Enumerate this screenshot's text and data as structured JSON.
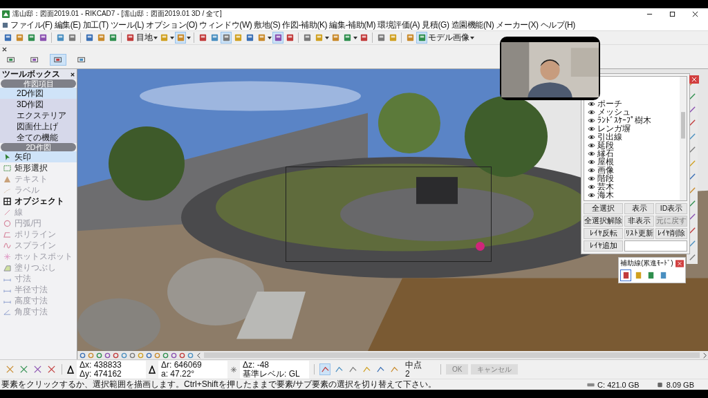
{
  "title_bar": {
    "title": "濡山邸：図面2019.01 - RIKCAD7 - [濡山邸：図面2019.01 3D / 全て]"
  },
  "menu": [
    "ファイル(F)",
    "編集(E)",
    "加工(T)",
    "ツール(L)",
    "オプション(O)",
    "ウィンドウ(W)",
    "敷地(S)",
    "作図-補助(K)",
    "編集-補助(M)",
    "環境評価(A)",
    "見積(G)",
    "造園機能(N)",
    "メーカー(X)",
    "ヘルプ(H)"
  ],
  "toolbar": [
    {
      "kind": "icon",
      "pressed": false
    },
    {
      "kind": "icon",
      "pressed": false
    },
    {
      "kind": "icon",
      "pressed": false
    },
    {
      "kind": "icon",
      "pressed": false
    },
    {
      "kind": "sep"
    },
    {
      "kind": "icon",
      "pressed": false
    },
    {
      "kind": "icon",
      "pressed": false
    },
    {
      "kind": "sep"
    },
    {
      "kind": "icon",
      "pressed": false
    },
    {
      "kind": "icon",
      "pressed": false
    },
    {
      "kind": "icon",
      "pressed": false
    },
    {
      "kind": "sep"
    },
    {
      "kind": "icon",
      "pressed": false
    },
    {
      "kind": "label",
      "text": "目地"
    },
    {
      "kind": "dropdown"
    },
    {
      "kind": "icon",
      "pressed": false
    },
    {
      "kind": "dropdown"
    },
    {
      "kind": "icon",
      "pressed": true
    },
    {
      "kind": "dropdown"
    },
    {
      "kind": "sep"
    },
    {
      "kind": "icon",
      "pressed": false
    },
    {
      "kind": "icon",
      "pressed": false
    },
    {
      "kind": "icon",
      "pressed": true
    },
    {
      "kind": "icon",
      "pressed": false
    },
    {
      "kind": "icon",
      "pressed": false
    },
    {
      "kind": "icon",
      "pressed": false
    },
    {
      "kind": "dropdown"
    },
    {
      "kind": "icon",
      "pressed": true
    },
    {
      "kind": "icon",
      "pressed": false
    },
    {
      "kind": "sep"
    },
    {
      "kind": "icon",
      "pressed": false
    },
    {
      "kind": "icon",
      "pressed": false
    },
    {
      "kind": "dropdown"
    },
    {
      "kind": "icon",
      "pressed": false
    },
    {
      "kind": "icon",
      "pressed": false
    },
    {
      "kind": "dropdown"
    },
    {
      "kind": "icon",
      "pressed": false
    },
    {
      "kind": "sep"
    },
    {
      "kind": "icon",
      "pressed": false
    },
    {
      "kind": "icon",
      "pressed": false
    },
    {
      "kind": "sep"
    },
    {
      "kind": "icon",
      "pressed": false
    },
    {
      "kind": "icon",
      "pressed": true
    },
    {
      "kind": "label",
      "text": "モデル画像"
    },
    {
      "kind": "dropdown"
    }
  ],
  "toolbar2": [
    {
      "pressed": false
    },
    {
      "pressed": false
    },
    {
      "pressed": true
    },
    {
      "pressed": false
    }
  ],
  "toolbox": {
    "title": "ツールボックス",
    "sections": [
      {
        "title": "作図項目",
        "kind": "category",
        "items": [
          {
            "label": "2D作図",
            "selected": true,
            "disabled": false
          },
          {
            "label": "3D作図",
            "selected": false,
            "disabled": false
          },
          {
            "label": "エクステリア",
            "selected": false,
            "disabled": false
          },
          {
            "label": "図面仕上げ",
            "selected": false,
            "disabled": false
          },
          {
            "label": "全ての機能",
            "selected": false,
            "disabled": false
          }
        ]
      },
      {
        "title": "2D作図",
        "kind": "tool",
        "items": [
          {
            "label": "矢印",
            "selected": true,
            "disabled": false
          },
          {
            "label": "矩形選択",
            "selected": false,
            "disabled": false
          },
          {
            "label": "テキスト",
            "selected": false,
            "disabled": true
          },
          {
            "label": "ラベル",
            "selected": false,
            "disabled": true
          },
          {
            "label": "オブジェクト",
            "selected": false,
            "disabled": false
          },
          {
            "label": "線",
            "selected": false,
            "disabled": true
          },
          {
            "label": "円弧/円",
            "selected": false,
            "disabled": true
          },
          {
            "label": "ポリライン",
            "selected": false,
            "disabled": true
          },
          {
            "label": "スプライン",
            "selected": false,
            "disabled": true
          },
          {
            "label": "ホットスポット",
            "selected": false,
            "disabled": true
          },
          {
            "label": "塗りつぶし",
            "selected": false,
            "disabled": true
          },
          {
            "label": "寸法",
            "selected": false,
            "disabled": true
          },
          {
            "label": "半径寸法",
            "selected": false,
            "disabled": true
          },
          {
            "label": "高度寸法",
            "selected": false,
            "disabled": true
          },
          {
            "label": "角度寸法",
            "selected": false,
            "disabled": true
          }
        ]
      }
    ]
  },
  "layers": {
    "rows": [
      {
        "name": "ポーチ",
        "visible": true
      },
      {
        "name": "メッシュ",
        "visible": true
      },
      {
        "name": "ﾗﾝﾄﾞｽｹｰﾌﾟ樹木",
        "visible": true
      },
      {
        "name": "レンガ塀",
        "visible": true
      },
      {
        "name": "引出線",
        "visible": true
      },
      {
        "name": "延段",
        "visible": true
      },
      {
        "name": "縁石",
        "visible": true
      },
      {
        "name": "屋根",
        "visible": true
      },
      {
        "name": "画像",
        "visible": true
      },
      {
        "name": "階段",
        "visible": true
      },
      {
        "name": "芸木",
        "visible": true
      },
      {
        "name": "海木",
        "visible": true
      }
    ],
    "buttons": [
      {
        "label": "全選択",
        "disabled": false
      },
      {
        "label": "表示",
        "disabled": false
      },
      {
        "label": "ID表示",
        "disabled": false
      },
      {
        "label": "全選択解除",
        "disabled": false
      },
      {
        "label": "非表示",
        "disabled": false
      },
      {
        "label": "元に戻す",
        "disabled": true
      },
      {
        "label": "ﾚｲﾔ反転",
        "disabled": false
      },
      {
        "label": "ﾘｽﾄ更新",
        "disabled": false
      },
      {
        "label": "ﾚｲﾔ削除",
        "disabled": false
      },
      {
        "label": "ﾚｲﾔ追加",
        "disabled": false
      }
    ]
  },
  "aux_palette": {
    "title": "補助線(累進ﾓｰﾄﾞ)",
    "tools": [
      {
        "selected": true
      },
      {
        "selected": false
      },
      {
        "selected": false
      },
      {
        "selected": false
      }
    ]
  },
  "coords": [
    {
      "label": "Δx:",
      "value": "438833"
    },
    {
      "label": "Δy:",
      "value": "474162"
    },
    {
      "label": "Δr:",
      "value": "646069"
    },
    {
      "label": "a:",
      "value": "47.22°"
    },
    {
      "label": "Δz:",
      "value": "-48"
    },
    {
      "label": "基準レベル:",
      "value": "GL"
    }
  ],
  "snap": {
    "label": "中点",
    "value": "2"
  },
  "actions": [
    {
      "label": "OK",
      "disabled": true
    },
    {
      "label": "キャンセル",
      "disabled": true
    }
  ],
  "status": {
    "message": "要素をクリックするか、選択範囲を描画します。Ctrl+Shiftを押したままで要素/サブ要素の選択を切り替えて下さい。",
    "disk": "C: 421.0 GB",
    "memory": "8.09 GB"
  }
}
